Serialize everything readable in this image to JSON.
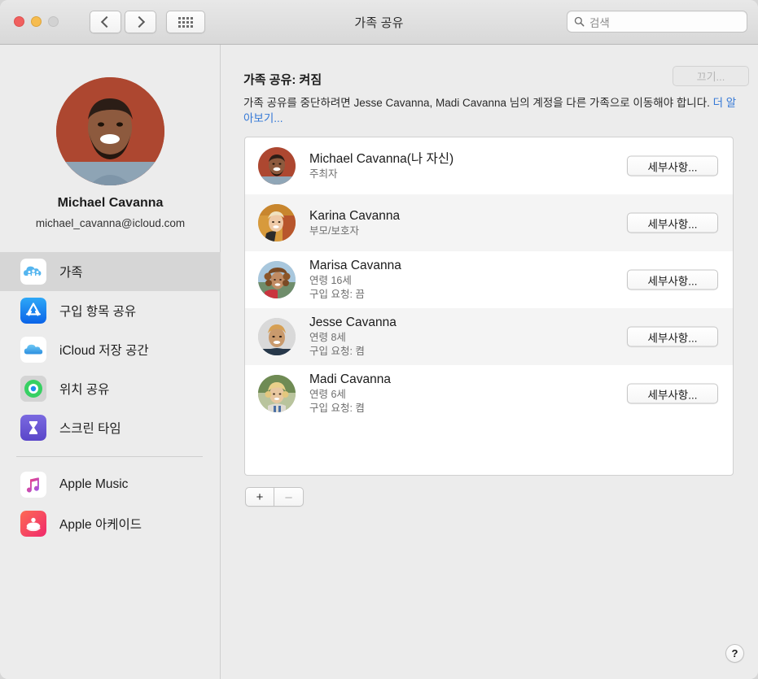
{
  "window": {
    "title": "가족 공유",
    "traffic_lights": [
      "close",
      "minimize",
      "zoom"
    ]
  },
  "toolbar": {
    "back_label": "‹",
    "forward_label": "›",
    "grid_label": "모두 보기",
    "search": {
      "placeholder": "검색",
      "value": "",
      "icon": "search-icon"
    }
  },
  "sidebar": {
    "profile": {
      "name": "Michael Cavanna",
      "email": "michael_cavanna@icloud.com",
      "avatar": "michael-avatar"
    },
    "items": [
      {
        "label": "가족",
        "icon": "family-cloud-icon",
        "selected": true
      },
      {
        "label": "구입 항목 공유",
        "icon": "app-store-icon",
        "selected": false
      },
      {
        "label": "iCloud 저장 공간",
        "icon": "icloud-icon",
        "selected": false
      },
      {
        "label": "위치 공유",
        "icon": "find-my-icon",
        "selected": false
      },
      {
        "label": "스크린 타임",
        "icon": "screen-time-icon",
        "selected": false
      }
    ],
    "items2": [
      {
        "label": "Apple Music",
        "icon": "apple-music-icon",
        "selected": false
      },
      {
        "label": "Apple 아케이드",
        "icon": "apple-arcade-icon",
        "selected": false
      }
    ]
  },
  "main": {
    "status_title": "가족 공유: 켜짐",
    "status_desc_before": "가족 공유를 중단하려면 Jesse Cavanna, Madi Cavanna 님의 계정을 다른 가족으로 이동해야 합니다. ",
    "status_desc_link": "더 알아보기...",
    "turn_off_label": "끄기...",
    "turn_off_disabled": true,
    "detail_button_label": "세부사항...",
    "members": [
      {
        "name": "Michael Cavanna(나 자신)",
        "sub1": "주최자",
        "sub2": "",
        "avatar": "michael-thumb"
      },
      {
        "name": "Karina Cavanna",
        "sub1": "부모/보호자",
        "sub2": "",
        "avatar": "karina-thumb"
      },
      {
        "name": "Marisa Cavanna",
        "sub1": "연령 16세",
        "sub2": "구입 요청: 끔",
        "avatar": "marisa-thumb"
      },
      {
        "name": "Jesse Cavanna",
        "sub1": "연령 8세",
        "sub2": "구입 요청: 켬",
        "avatar": "jesse-thumb"
      },
      {
        "name": "Madi Cavanna",
        "sub1": "연령 6세",
        "sub2": "구입 요청: 켬",
        "avatar": "madi-thumb"
      }
    ],
    "add_label": "+",
    "remove_label": "–",
    "help_label": "?"
  },
  "colors": {
    "link": "#3478d6",
    "window_bg": "#ececec",
    "list_bg": "#ffffff",
    "list_alt": "#f4f4f4",
    "selected_row": "#d6d6d6"
  }
}
